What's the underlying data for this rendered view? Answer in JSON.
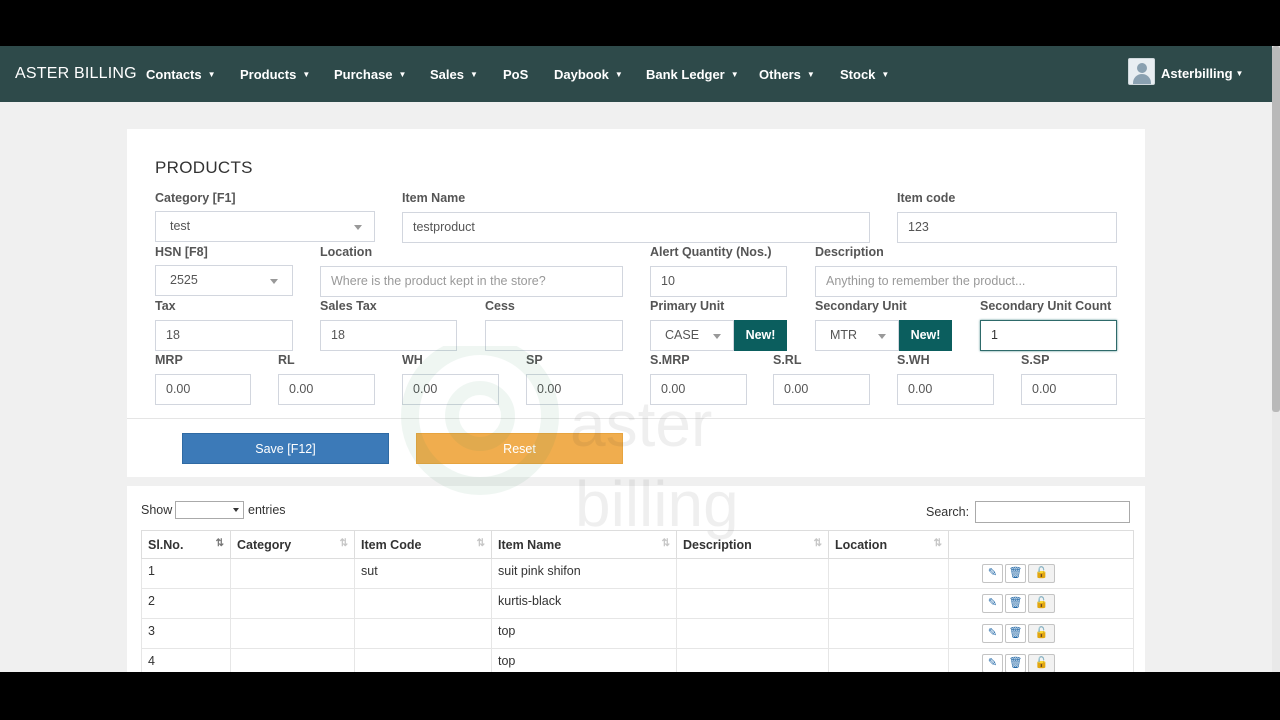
{
  "nav": {
    "brand": "ASTER BILLING",
    "items": [
      "Contacts",
      "Products",
      "Purchase",
      "Sales",
      "PoS",
      "Daybook",
      "Bank Ledger",
      "Others",
      "Stock"
    ],
    "user": "Asterbilling"
  },
  "form": {
    "title": "PRODUCTS",
    "category": {
      "label": "Category [F1]",
      "value": "test"
    },
    "item_name": {
      "label": "Item Name",
      "value": "testproduct"
    },
    "item_code": {
      "label": "Item code",
      "value": "123"
    },
    "hsn": {
      "label": "HSN [F8]",
      "value": "2525"
    },
    "location": {
      "label": "Location",
      "placeholder": "Where is the product kept in the store?"
    },
    "alert_qty": {
      "label": "Alert Quantity (Nos.)",
      "value": "10"
    },
    "description": {
      "label": "Description",
      "placeholder": "Anything to remember the product..."
    },
    "tax": {
      "label": "Tax",
      "value": "18"
    },
    "sales_tax": {
      "label": "Sales Tax",
      "value": "18"
    },
    "cess": {
      "label": "Cess",
      "value": ""
    },
    "primary_unit": {
      "label": "Primary Unit",
      "value": "CASE",
      "new_label": "New!"
    },
    "secondary_unit": {
      "label": "Secondary Unit",
      "value": "MTR",
      "new_label": "New!"
    },
    "secondary_unit_count": {
      "label": "Secondary Unit Count",
      "value": "1"
    },
    "prices": [
      {
        "label": "MRP",
        "value": "0.00"
      },
      {
        "label": "RL",
        "value": "0.00"
      },
      {
        "label": "WH",
        "value": "0.00"
      },
      {
        "label": "SP",
        "value": "0.00"
      },
      {
        "label": "S.MRP",
        "value": "0.00"
      },
      {
        "label": "S.RL",
        "value": "0.00"
      },
      {
        "label": "S.WH",
        "value": "0.00"
      },
      {
        "label": "S.SP",
        "value": "0.00"
      }
    ],
    "save_label": "Save [F12]",
    "reset_label": "Reset"
  },
  "table": {
    "show_label": "Show",
    "entries_label": "entries",
    "search_label": "Search:",
    "columns": [
      "Sl.No.",
      "Category",
      "Item Code",
      "Item Name",
      "Description",
      "Location",
      ""
    ],
    "rows": [
      {
        "sl": "1",
        "category": "",
        "code": "sut",
        "name": "suit pink shifon",
        "description": "",
        "location": ""
      },
      {
        "sl": "2",
        "category": "",
        "code": "",
        "name": "kurtis-black",
        "description": "",
        "location": ""
      },
      {
        "sl": "3",
        "category": "",
        "code": "",
        "name": "top",
        "description": "",
        "location": ""
      },
      {
        "sl": "4",
        "category": "",
        "code": "",
        "name": "top",
        "description": "",
        "location": ""
      }
    ]
  },
  "colors": {
    "navbar": "#2e4a4a",
    "new_button": "#0b5e5e",
    "save": "#3c7ab8",
    "reset": "#f0ad4e"
  }
}
